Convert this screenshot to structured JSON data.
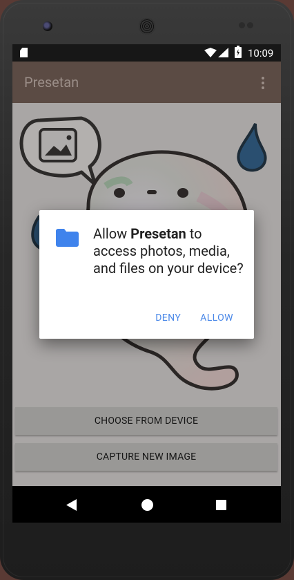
{
  "status_bar": {
    "time": "10:09",
    "icons": [
      "sd-card-icon",
      "wifi-icon",
      "cell-signal-icon",
      "battery-charging-icon"
    ]
  },
  "app_bar": {
    "title": "Presetan",
    "menu_icon": "overflow-menu-icon"
  },
  "buttons": {
    "choose": "CHOOSE FROM DEVICE",
    "capture": "CAPTURE NEW IMAGE"
  },
  "dialog": {
    "icon": "folder-icon",
    "message_prefix": "Allow ",
    "app_name": "Presetan",
    "message_suffix": " to access photos, media, and files on your device?",
    "deny_label": "DENY",
    "allow_label": "ALLOW"
  },
  "nav_bar": {
    "icons": [
      "back-icon",
      "home-icon",
      "recents-icon"
    ]
  },
  "colors": {
    "app_bar": "#5b4b44",
    "dialog_accent": "#4a88e8",
    "folder": "#3f83ec",
    "scrim": "#a9a6a5"
  }
}
